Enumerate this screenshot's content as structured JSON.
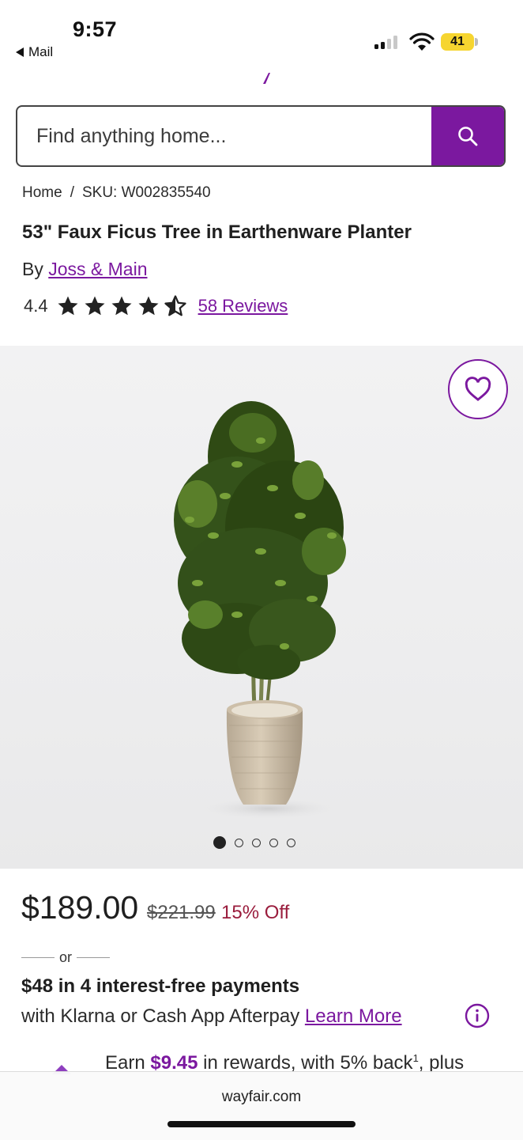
{
  "status_bar": {
    "time": "9:57",
    "back_app": "Mail",
    "battery": "41",
    "battery_color": "#f6d530"
  },
  "brand": {
    "accent": "#7b189f",
    "sale_color": "#9a1d3d"
  },
  "search": {
    "placeholder": "Find anything home...",
    "icon": "search-icon"
  },
  "breadcrumb": {
    "home": "Home",
    "separator": "/",
    "sku": "SKU: W002835540"
  },
  "product": {
    "title": "53\" Faux Ficus Tree in Earthenware Planter",
    "by_prefix": "By",
    "brand_name": "Joss & Main",
    "rating": "4.4",
    "rating_value": 4.4,
    "rating_max": 5,
    "reviews": "58 Reviews"
  },
  "gallery": {
    "image_count": 5,
    "active_index": 0,
    "favorite_icon": "heart-outline-icon"
  },
  "pricing": {
    "price": "$189.00",
    "was_price": "$221.99",
    "discount": "15% Off"
  },
  "financing": {
    "or": "or",
    "headline": "$48 in 4 interest-free payments",
    "subtext": "with Klarna or Cash App Afterpay",
    "learn_more": "Learn More",
    "info_icon": "info-icon"
  },
  "rewards": {
    "prefix": "Earn",
    "amount": "$9.45",
    "suffix": "in rewards, with 5% back",
    "footnote": "1",
    "tail": ", plus"
  },
  "browser": {
    "url": "wayfair.com"
  }
}
